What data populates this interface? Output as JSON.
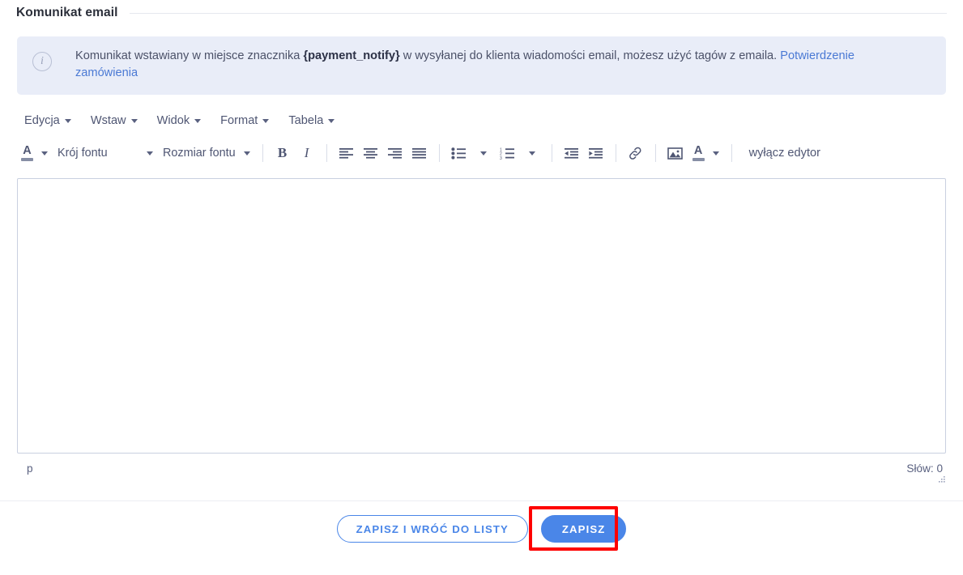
{
  "section": {
    "title": "Komunikat email"
  },
  "info_banner": {
    "icon": "info-circle-icon",
    "text_part1": "Komunikat wstawiany w miejsce znacznika ",
    "placeholder_tag": "{payment_notify}",
    "text_part2": " w wysyłanej do klienta wiadomości email, możesz użyć tagów z emaila. ",
    "link_label": "Potwierdzenie zamówienia",
    "bg_color": "#e9edf8",
    "link_color": "#4a79d4"
  },
  "menubar": {
    "items": [
      {
        "label": "Edycja",
        "name": "menu-edycja"
      },
      {
        "label": "Wstaw",
        "name": "menu-wstaw"
      },
      {
        "label": "Widok",
        "name": "menu-widok"
      },
      {
        "label": "Format",
        "name": "menu-format"
      },
      {
        "label": "Tabela",
        "name": "menu-tabela"
      }
    ]
  },
  "toolbar": {
    "formats_icon": "text-color-a-icon",
    "font_family_label": "Krój fontu",
    "font_size_label": "Rozmiar fontu",
    "bold_label": "B",
    "italic_label": "I",
    "align_left": "align-left-icon",
    "align_center": "align-center-icon",
    "align_right": "align-right-icon",
    "align_justify": "align-justify-icon",
    "bullet_list": "bullet-list-icon",
    "numbered_list": "numbered-list-icon",
    "outdent": "outdent-icon",
    "indent": "indent-icon",
    "link": "link-icon",
    "image": "image-icon",
    "text_color": "text-color-icon",
    "disable_editor_label": "wyłącz edytor"
  },
  "editor": {
    "content": "",
    "placeholder": "",
    "status_path": "p",
    "word_count_label": "Słów: 0",
    "border_color": "#c9d0e0"
  },
  "footer": {
    "save_and_back_label": "ZAPISZ I WRÓĆ DO LISTY",
    "save_label": "ZAPISZ",
    "primary_color": "#4a86e8",
    "highlight_color": "#fe0000"
  }
}
